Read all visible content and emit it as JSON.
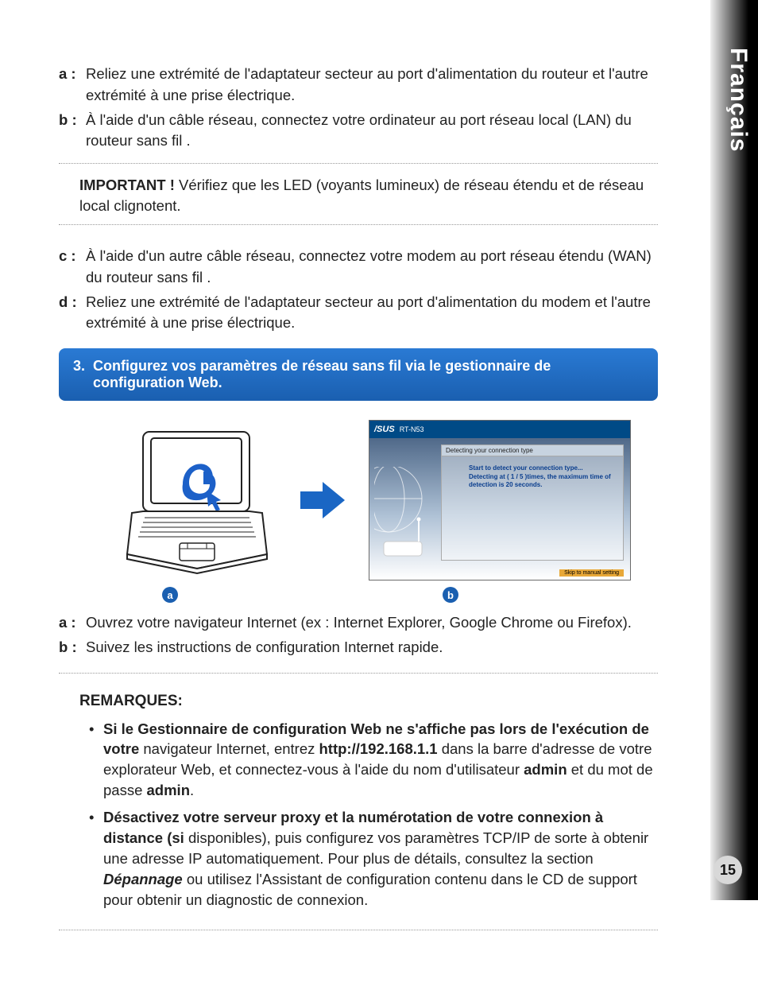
{
  "side_tab": "Français",
  "steps1": {
    "a": {
      "label": "a :",
      "text": "Reliez une extrémité de l'adaptateur secteur au port d'alimentation du routeur et l'autre extrémité à une prise électrique."
    },
    "b": {
      "label": "b :",
      "text": "À l'aide d'un câble réseau, connectez votre ordinateur au port réseau local (LAN) du routeur sans fil ."
    }
  },
  "important_box": {
    "label": "IMPORTANT !",
    "text": "  Vérifiez que les LED (voyants lumineux) de réseau étendu et de réseau local clignotent."
  },
  "steps2": {
    "c": {
      "label": "c :",
      "text": "À l'aide d'un autre câble réseau, connectez votre modem au port réseau étendu (WAN) du routeur sans fil ."
    },
    "d": {
      "label": "d :",
      "text": "Reliez une extrémité de l'adaptateur secteur au port d'alimentation du modem et l'autre extrémité à une prise électrique."
    }
  },
  "blue_bar": {
    "num": "3.",
    "text": "Configurez vos paramètres de réseau sans fil via le gestionnaire de configuration Web."
  },
  "screenshot": {
    "logo": "/SUS",
    "model": "RT-N53",
    "panel_title": "Detecting your connection type",
    "msg1": "Start to detect your connection type...",
    "msg2": "Detecting at ( 1 / 5 )times, the maximum time of",
    "msg3": "detection is 20 seconds.",
    "footer": "Skip to manual setting"
  },
  "labels": {
    "a": "a",
    "b": "b"
  },
  "steps3": {
    "a": {
      "label": "a :",
      "text": " Ouvrez votre navigateur Internet (ex : Internet Explorer, Google Chrome ou Firefox)."
    },
    "b": {
      "label": "b :",
      "text": " Suivez les instructions de configuration Internet rapide."
    }
  },
  "remarks": {
    "title": "REMARQUES:",
    "item1": {
      "seg1": "Si le Gestionnaire de configuration Web ne s'affiche pas lors de l'exécution de votre ",
      "seg2_plain": "navigateur Internet, entrez ",
      "seg3_bold": "http://192.168.1.1",
      "seg4_plain": " dans la barre d'adresse de votre explorateur Web, et connectez-vous à l'aide du nom d'utilisateur ",
      "seg5_bold": "admin",
      "seg6_plain": " et du mot de passe ",
      "seg7_bold": "admin",
      "seg8_plain": "."
    },
    "item2": {
      "seg1": "Désactivez votre serveur proxy et la numérotation de votre connexion à distance (si ",
      "seg2_plain": "disponibles), puis configurez vos paramètres TCP/IP de sorte à obtenir une adresse IP automatiquement. Pour plus de détails, consultez la section ",
      "seg3_bi": "Dépannage",
      "seg4_plain": " ou utilisez l'Assistant de configuration contenu dans le CD de support pour obtenir un diagnostic de connexion."
    }
  },
  "page_number": "15"
}
